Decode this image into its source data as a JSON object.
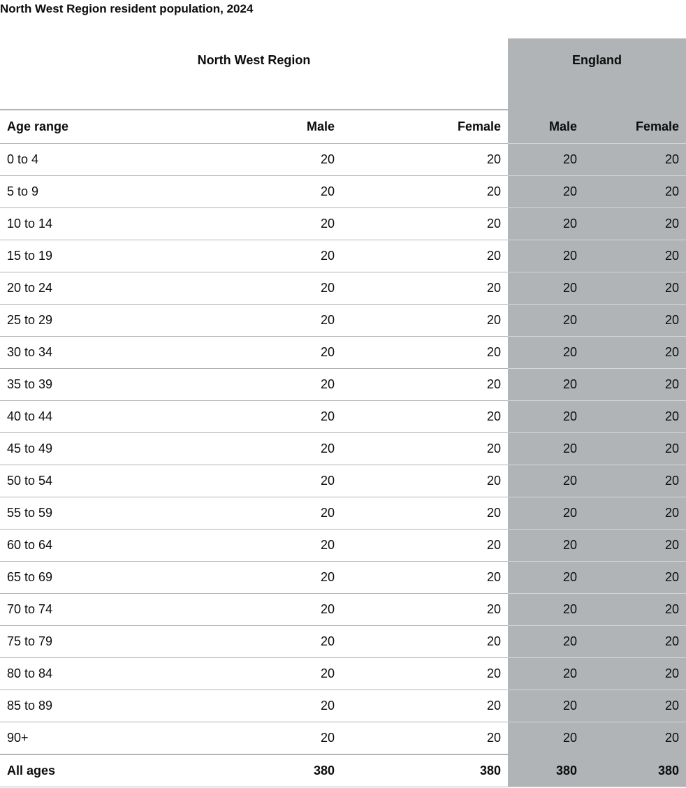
{
  "caption": "North West Region resident population, 2024",
  "groups": {
    "region": "North West Region",
    "comparison": "England"
  },
  "columns": {
    "age": "Age range",
    "region_male": "Male",
    "region_female": "Female",
    "england_male": "Male",
    "england_female": "Female"
  },
  "rows": [
    {
      "age": "0 to 4",
      "nw_male": "20",
      "nw_female": "20",
      "en_male": "20",
      "en_female": "20"
    },
    {
      "age": "5 to 9",
      "nw_male": "20",
      "nw_female": "20",
      "en_male": "20",
      "en_female": "20"
    },
    {
      "age": "10 to 14",
      "nw_male": "20",
      "nw_female": "20",
      "en_male": "20",
      "en_female": "20"
    },
    {
      "age": "15 to 19",
      "nw_male": "20",
      "nw_female": "20",
      "en_male": "20",
      "en_female": "20"
    },
    {
      "age": "20 to 24",
      "nw_male": "20",
      "nw_female": "20",
      "en_male": "20",
      "en_female": "20"
    },
    {
      "age": "25 to 29",
      "nw_male": "20",
      "nw_female": "20",
      "en_male": "20",
      "en_female": "20"
    },
    {
      "age": "30 to 34",
      "nw_male": "20",
      "nw_female": "20",
      "en_male": "20",
      "en_female": "20"
    },
    {
      "age": "35 to 39",
      "nw_male": "20",
      "nw_female": "20",
      "en_male": "20",
      "en_female": "20"
    },
    {
      "age": "40 to 44",
      "nw_male": "20",
      "nw_female": "20",
      "en_male": "20",
      "en_female": "20"
    },
    {
      "age": "45 to 49",
      "nw_male": "20",
      "nw_female": "20",
      "en_male": "20",
      "en_female": "20"
    },
    {
      "age": "50 to 54",
      "nw_male": "20",
      "nw_female": "20",
      "en_male": "20",
      "en_female": "20"
    },
    {
      "age": "55 to 59",
      "nw_male": "20",
      "nw_female": "20",
      "en_male": "20",
      "en_female": "20"
    },
    {
      "age": "60 to 64",
      "nw_male": "20",
      "nw_female": "20",
      "en_male": "20",
      "en_female": "20"
    },
    {
      "age": "65 to 69",
      "nw_male": "20",
      "nw_female": "20",
      "en_male": "20",
      "en_female": "20"
    },
    {
      "age": "70 to 74",
      "nw_male": "20",
      "nw_female": "20",
      "en_male": "20",
      "en_female": "20"
    },
    {
      "age": "75 to 79",
      "nw_male": "20",
      "nw_female": "20",
      "en_male": "20",
      "en_female": "20"
    },
    {
      "age": "80 to 84",
      "nw_male": "20",
      "nw_female": "20",
      "en_male": "20",
      "en_female": "20"
    },
    {
      "age": "85 to 89",
      "nw_male": "20",
      "nw_female": "20",
      "en_male": "20",
      "en_female": "20"
    },
    {
      "age": "90+",
      "nw_male": "20",
      "nw_female": "20",
      "en_male": "20",
      "en_female": "20"
    }
  ],
  "total": {
    "age": "All ages",
    "nw_male": "380",
    "nw_female": "380",
    "en_male": "380",
    "en_female": "380"
  },
  "colors": {
    "text": "#0b0c0c",
    "england_shading": "#b1b4b6",
    "border": "#b1b4b6"
  }
}
